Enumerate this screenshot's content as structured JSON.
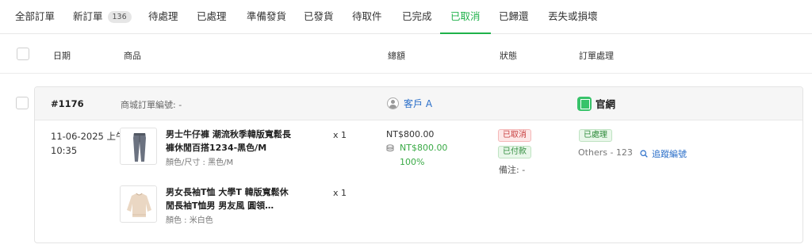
{
  "tabs": [
    {
      "label": "全部訂單"
    },
    {
      "label": "新訂單",
      "count": "136"
    },
    {
      "label": "待處理"
    },
    {
      "label": "已處理"
    },
    {
      "label": "準備發貨"
    },
    {
      "label": "已發貨"
    },
    {
      "label": "待取件"
    },
    {
      "label": "已完成"
    },
    {
      "label": "已取消",
      "active": true
    },
    {
      "label": "已歸還"
    },
    {
      "label": "丟失或損壞"
    }
  ],
  "columns": {
    "date": "日期",
    "product": "商品",
    "total": "總額",
    "status": "狀態",
    "handling": "訂單處理"
  },
  "order": {
    "number": "#1176",
    "mall_number": "商城訂單編號: -",
    "customer": "客戶 A",
    "channel": "官網",
    "date": "11-06-2025 上午",
    "time": "10:35",
    "items": [
      {
        "name": "男士牛仔褲 潮流秋季韓版寬鬆長褲休閒百搭1234-黑色/M",
        "variant": "顏色/尺寸 : 黑色/M",
        "qty": "x 1"
      },
      {
        "name": "男女長袖T恤 大學T 韓版寬鬆休閒長袖T恤男 男友風 圓領…",
        "variant": "顏色 : 米白色",
        "qty": "x 1"
      }
    ],
    "total": "NT$800.00",
    "paid": "NT$800.00",
    "paid_percent": "100%",
    "status_badges": [
      "已取消",
      "已付款"
    ],
    "note": "備注: -",
    "handling_badge": "已處理",
    "tracking_code": "Others - 123",
    "tracking_link": "追蹤編號"
  },
  "colors": {
    "accent": "#1fb24a",
    "link": "#2b6fc9",
    "cancelled": "#c84040",
    "paid": "#3aaa46"
  }
}
